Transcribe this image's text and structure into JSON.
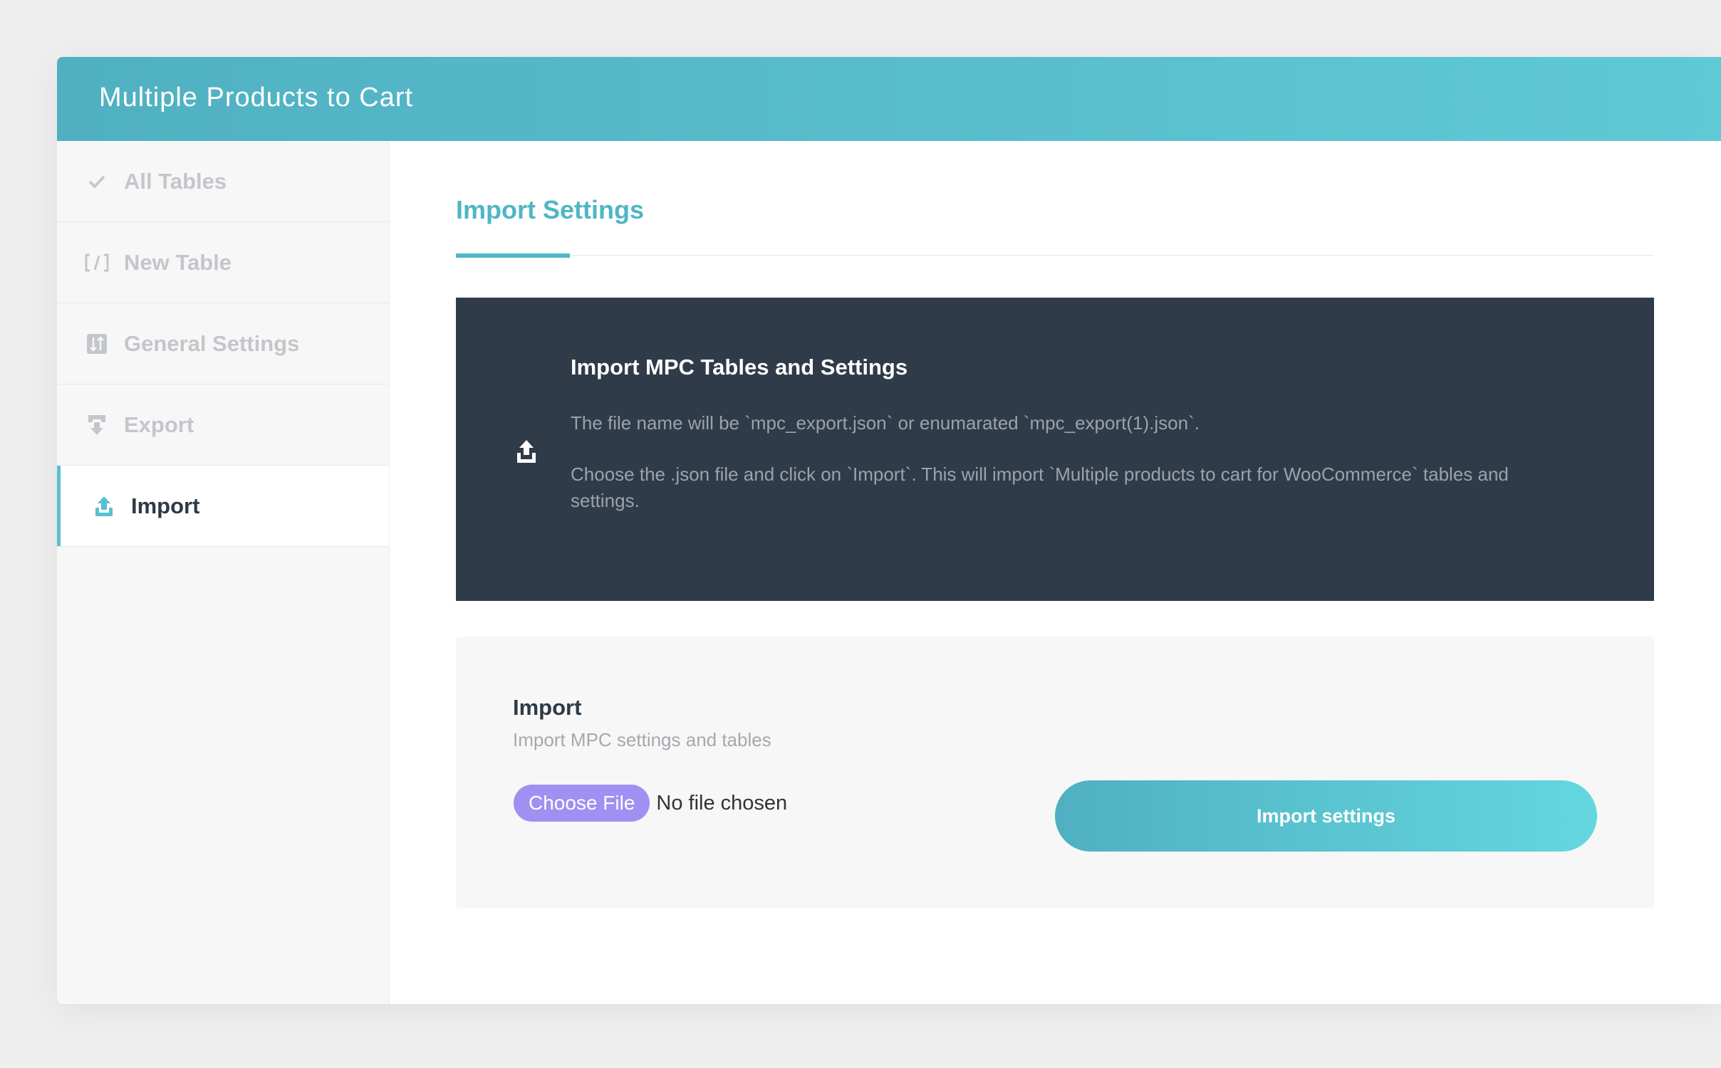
{
  "app": {
    "title": "Multiple Products to Cart"
  },
  "sidebar": {
    "items": [
      {
        "label": "All Tables",
        "icon": "check-icon"
      },
      {
        "label": "New Table",
        "icon": "code-brackets-icon"
      },
      {
        "label": "General Settings",
        "icon": "sliders-icon"
      },
      {
        "label": "Export",
        "icon": "download-icon"
      },
      {
        "label": "Import",
        "icon": "upload-icon",
        "active": true
      }
    ]
  },
  "main": {
    "tab_title": "Import Settings",
    "info": {
      "title": "Import MPC Tables and Settings",
      "line1": "The file name will be `mpc_export.json` or enumarated `mpc_export(1).json`.",
      "line2": "Choose the .json file and click on `Import`. This will import `Multiple products to cart for WooCommerce` tables and settings."
    },
    "import_card": {
      "title": "Import",
      "subtitle": "Import MPC settings and tables",
      "choose_file_label": "Choose File",
      "file_status": "No file chosen",
      "submit_label": "Import settings"
    }
  },
  "colors": {
    "accent": "#4fb6c5",
    "header_start": "#50b0c1",
    "header_end": "#5fc9d6",
    "info_bg": "#2f3b48",
    "choose_file_bg": "#9f90f2"
  }
}
